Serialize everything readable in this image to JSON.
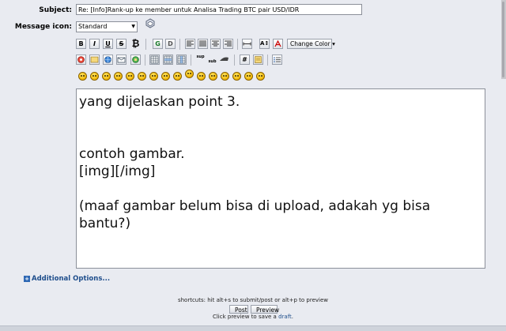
{
  "form": {
    "subject_label": "Subject:",
    "subject_value": "Re: [Info]Rank-up ke member untuk Analisa Trading BTC pair USD/IDR",
    "icon_label": "Message icon:",
    "icon_selected": "Standard"
  },
  "toolbar": {
    "bold": "B",
    "italic": "I",
    "underline": "U",
    "strike": "S",
    "bitcoin": "₿",
    "change_color": "Change Color ▾",
    "hash": "#"
  },
  "editor": {
    "lines": [
      "yang dijelaskan point 3.",
      "",
      "",
      "contoh gambar.",
      "[img][/img]",
      "",
      "(maaf gambar belum bisa di upload, adakah yg bisa",
      "bantu?)"
    ]
  },
  "footer": {
    "additional_options": "Additional Options...",
    "shortcuts": "shortcuts: hit alt+s to submit/post or alt+p to preview",
    "post": "Post",
    "preview": "Preview",
    "draft_prefix": "Click preview to save a ",
    "draft_link": "draft",
    "draft_suffix": "."
  },
  "colors": {
    "link": "#1f4e8c",
    "page_bg": "#e9ebf1"
  }
}
